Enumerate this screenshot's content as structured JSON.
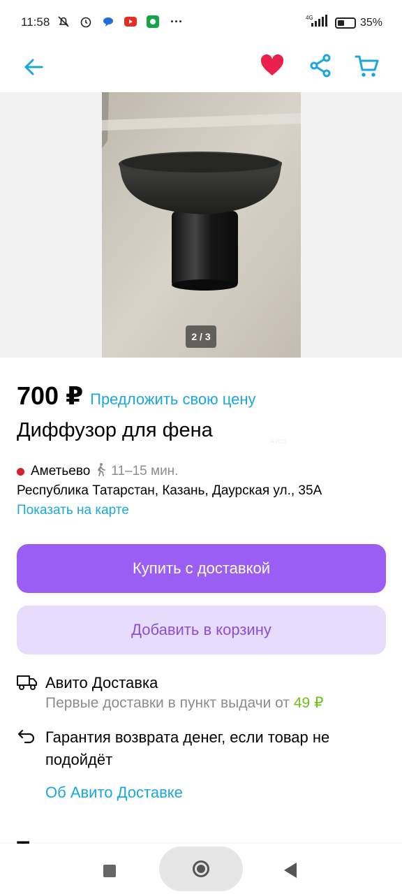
{
  "status_bar": {
    "time": "11:58",
    "network": "4G",
    "battery": "35%",
    "battery_level": 0.35,
    "more": "···"
  },
  "app_bar": {
    "back_icon": "arrow-left-icon",
    "favorite_icon": "heart-icon",
    "share_icon": "share-icon",
    "cart_icon": "cart-icon",
    "accent": "#1aa7e0",
    "favorite_color": "#e8204b"
  },
  "gallery": {
    "counter": "2 / 3",
    "watermark": "Avito"
  },
  "listing": {
    "price": "700 ₽",
    "offer_link": "Предложить свою цену",
    "title": "Диффузор для фена",
    "metro": "Аметьево",
    "walk_time": "11–15 мин.",
    "address": "Республика Татарстан, Казань, Даурская ул., 35А",
    "map_link": "Показать на карте"
  },
  "actions": {
    "buy_label": "Купить с доставкой",
    "cart_label": "Добавить в корзину",
    "buy_color": "#9b5ef5",
    "cart_color": "#e8dcfd"
  },
  "delivery": {
    "title": "Авито Доставка",
    "subtitle_prefix": "Первые доставки в пункт выдачи от",
    "subtitle_price": "49 ₽",
    "guarantee": "Гарантия возврата денег, если товар не подойдёт",
    "about_link": "Об Авито Доставке"
  },
  "seller": {
    "name_peek": "Татьяна"
  }
}
